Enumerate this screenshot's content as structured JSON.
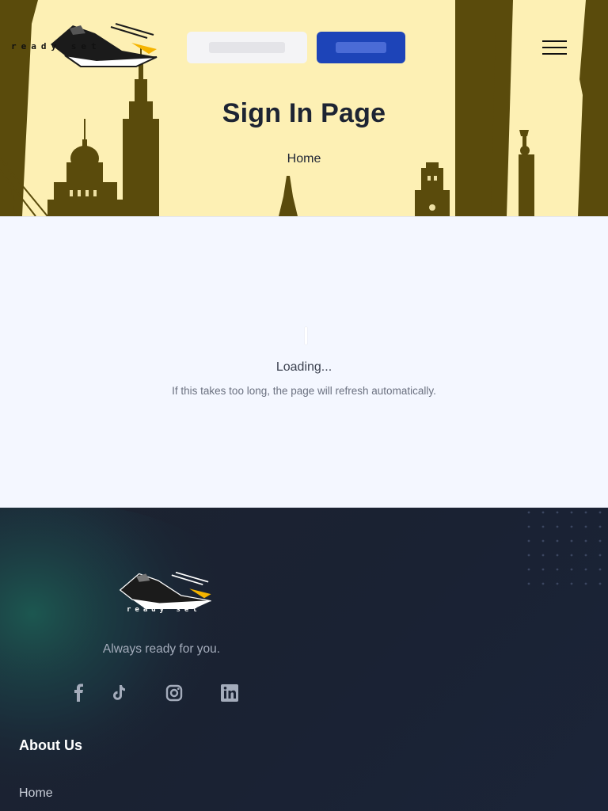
{
  "header": {
    "logo_text": "ready set",
    "sign_in_placeholder": "",
    "sign_up_placeholder": "",
    "page_title": "Sign In Page",
    "breadcrumb_home": "Home"
  },
  "main": {
    "loading_title": "Loading...",
    "loading_message": "If this takes too long, the page will refresh automatically."
  },
  "footer": {
    "logo_text": "ready set",
    "tagline": "Always ready for you.",
    "social_icons": [
      "facebook-icon",
      "tiktok-icon",
      "instagram-icon",
      "linkedin-icon"
    ],
    "section_heading": "About Us",
    "links": [
      "Home"
    ]
  },
  "colors": {
    "hero_bg": "#fdf0b4",
    "skyline": "#5a4b0c",
    "primary_button": "#1d44b8",
    "footer_bg": "#1a2233",
    "footer_glow": "#1c5a52"
  }
}
